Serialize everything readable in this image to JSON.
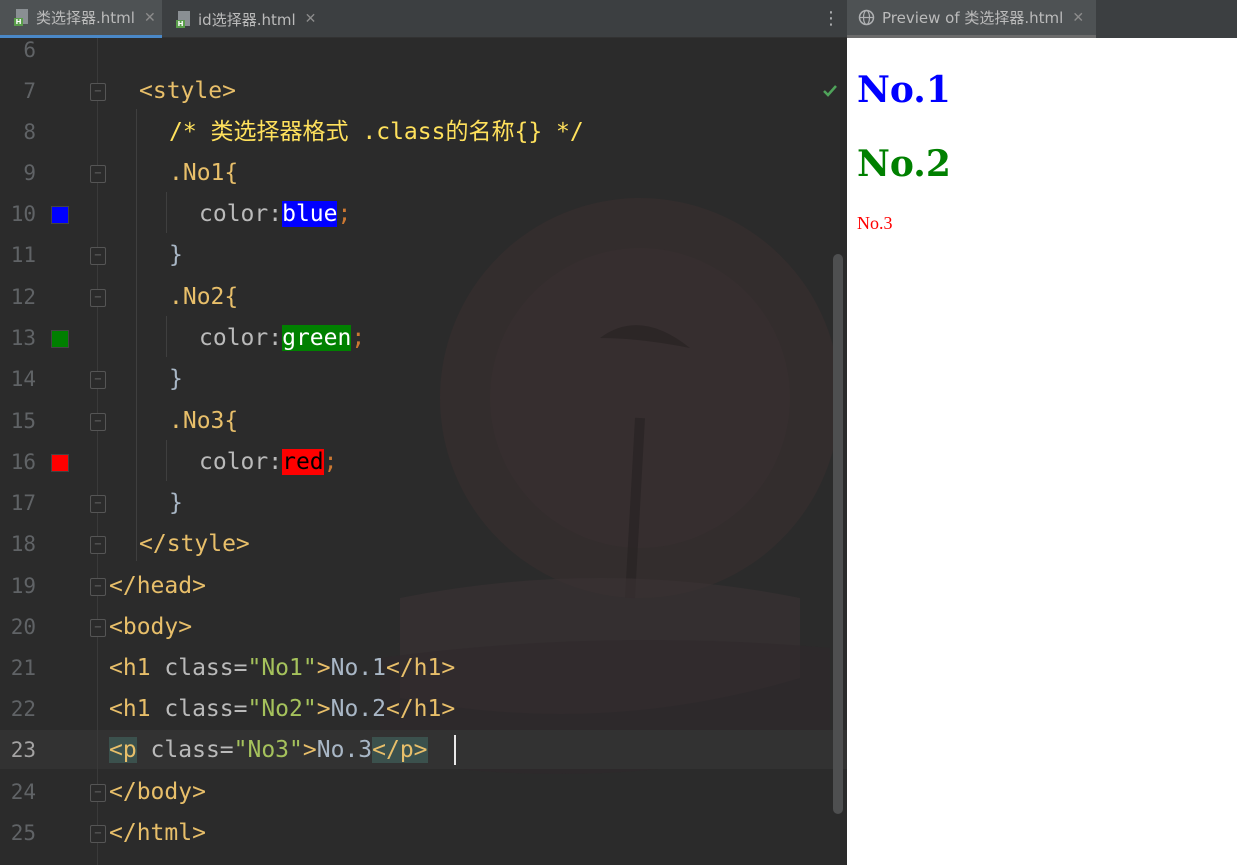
{
  "editor": {
    "tabs": [
      {
        "label": "类选择器.html",
        "active": true
      },
      {
        "label": "id选择器.html",
        "active": false
      }
    ],
    "menu_icon": "vertical-ellipsis-icon",
    "status_icon": "checkmark-icon",
    "colors": {
      "blue_swatch": "#0000ff",
      "green_swatch": "#008000",
      "red_swatch": "#ff0000"
    },
    "lines": [
      {
        "no": "6"
      },
      {
        "no": "7",
        "code": [
          "<style>"
        ]
      },
      {
        "no": "8",
        "code": [
          "/* 类选择器格式 .class的名称{} */"
        ]
      },
      {
        "no": "9",
        "code": [
          ".No1{"
        ]
      },
      {
        "no": "10",
        "code": [
          "color:",
          "blue",
          ";"
        ]
      },
      {
        "no": "11",
        "code": [
          "}"
        ]
      },
      {
        "no": "12",
        "code": [
          ".No2{"
        ]
      },
      {
        "no": "13",
        "code": [
          "color:",
          "green",
          ";"
        ]
      },
      {
        "no": "14",
        "code": [
          "}"
        ]
      },
      {
        "no": "15",
        "code": [
          ".No3{"
        ]
      },
      {
        "no": "16",
        "code": [
          "color:",
          "red",
          ";"
        ]
      },
      {
        "no": "17",
        "code": [
          "}"
        ]
      },
      {
        "no": "18",
        "code": [
          "</style>"
        ]
      },
      {
        "no": "19",
        "code": [
          "</head>"
        ]
      },
      {
        "no": "20",
        "code": [
          "<body>"
        ]
      },
      {
        "no": "21",
        "code": [
          "<h1 ",
          "class=",
          "\"No1\"",
          ">",
          "No.1",
          "</h1>"
        ]
      },
      {
        "no": "22",
        "code": [
          "<h1 ",
          "class=",
          "\"No2\"",
          ">",
          "No.2",
          "</h1>"
        ]
      },
      {
        "no": "23",
        "code": [
          "<p",
          " class=",
          "\"No3\"",
          ">",
          "No.3",
          "</p>"
        ]
      },
      {
        "no": "24",
        "code": [
          "</body>"
        ]
      },
      {
        "no": "25",
        "code": [
          "</html>"
        ]
      }
    ]
  },
  "preview": {
    "tab_label": "Preview of 类选择器.html",
    "h1_first": "No.1",
    "h1_second": "No.2",
    "paragraph": "No.3",
    "colors": {
      "no1": "#0000ff",
      "no2": "#008000",
      "no3": "#ff0000"
    }
  }
}
